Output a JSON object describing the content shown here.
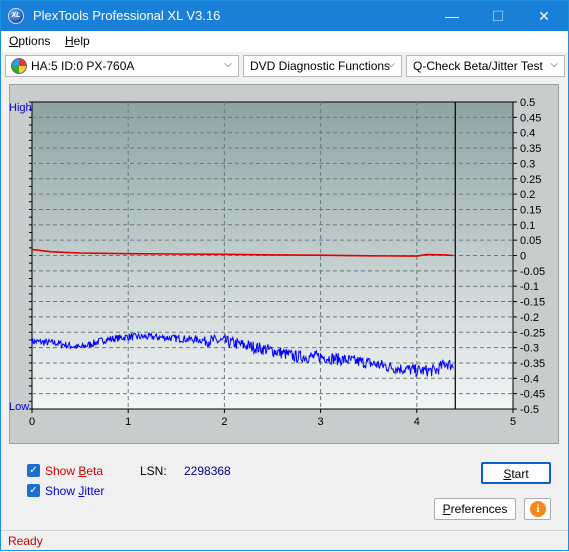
{
  "window": {
    "title": "PlexTools Professional XL V3.16",
    "app_icon_text": "XL",
    "minimize_glyph": "—",
    "maximize_glyph": "☐",
    "close_glyph": "✕"
  },
  "menu": {
    "items": [
      {
        "key": "O",
        "rest": "ptions"
      },
      {
        "key": "H",
        "rest": "elp"
      }
    ]
  },
  "toolbar": {
    "drive": "HA:5 ID:0  PX-760A",
    "function": "DVD Diagnostic Functions",
    "test": "Q-Check Beta/Jitter Test",
    "arrow": "⌵"
  },
  "chart_labels": {
    "high": "High",
    "low": "Low"
  },
  "chart_data": {
    "type": "line",
    "x_ticks": [
      "0",
      "1",
      "2",
      "3",
      "4",
      "5"
    ],
    "xlim": [
      0,
      5
    ],
    "y_right_ticks": [
      "0.5",
      "0.45",
      "0.4",
      "0.35",
      "0.3",
      "0.25",
      "0.2",
      "0.15",
      "0.1",
      "0.05",
      "0",
      "-0.05",
      "-0.1",
      "-0.15",
      "-0.2",
      "-0.25",
      "-0.3",
      "-0.35",
      "-0.4",
      "-0.45",
      "-0.5"
    ],
    "ylim": [
      -0.5,
      0.5
    ],
    "grid": true,
    "end_marker_x": 4.4,
    "series": [
      {
        "color": "#e00000",
        "x": [
          0,
          0.2,
          0.5,
          1.0,
          1.5,
          2.0,
          2.5,
          3.0,
          3.5,
          4.0,
          4.1,
          4.3,
          4.38
        ],
        "y": [
          0.02,
          0.012,
          0.008,
          0.006,
          0.005,
          0.004,
          0.002,
          0.001,
          -0.001,
          -0.002,
          0.003,
          0.002,
          0.0
        ]
      },
      {
        "color": "#0000ff",
        "x": [
          0,
          0.25,
          0.5,
          0.75,
          1.0,
          1.25,
          1.5,
          1.75,
          2.0,
          2.25,
          2.5,
          2.75,
          3.0,
          3.25,
          3.5,
          3.75,
          4.0,
          4.2,
          4.3,
          4.38
        ],
        "y": [
          -0.28,
          -0.285,
          -0.3,
          -0.275,
          -0.265,
          -0.265,
          -0.27,
          -0.275,
          -0.28,
          -0.295,
          -0.31,
          -0.33,
          -0.33,
          -0.34,
          -0.35,
          -0.365,
          -0.375,
          -0.375,
          -0.35,
          -0.36
        ]
      }
    ]
  },
  "options": {
    "show_beta": {
      "pre": "Show ",
      "key": "B",
      "post": "eta",
      "checked": true,
      "color": "#cc0000"
    },
    "show_jitter": {
      "pre": "Show ",
      "key": "J",
      "post": "itter",
      "checked": true,
      "color": "#0000cc"
    }
  },
  "lsn": {
    "label": "LSN:",
    "value": "2298368"
  },
  "buttons": {
    "start": {
      "key": "S",
      "rest": "tart"
    },
    "preferences": {
      "key": "P",
      "rest": "references"
    },
    "info_glyph": "i"
  },
  "status": {
    "text": "Ready"
  }
}
